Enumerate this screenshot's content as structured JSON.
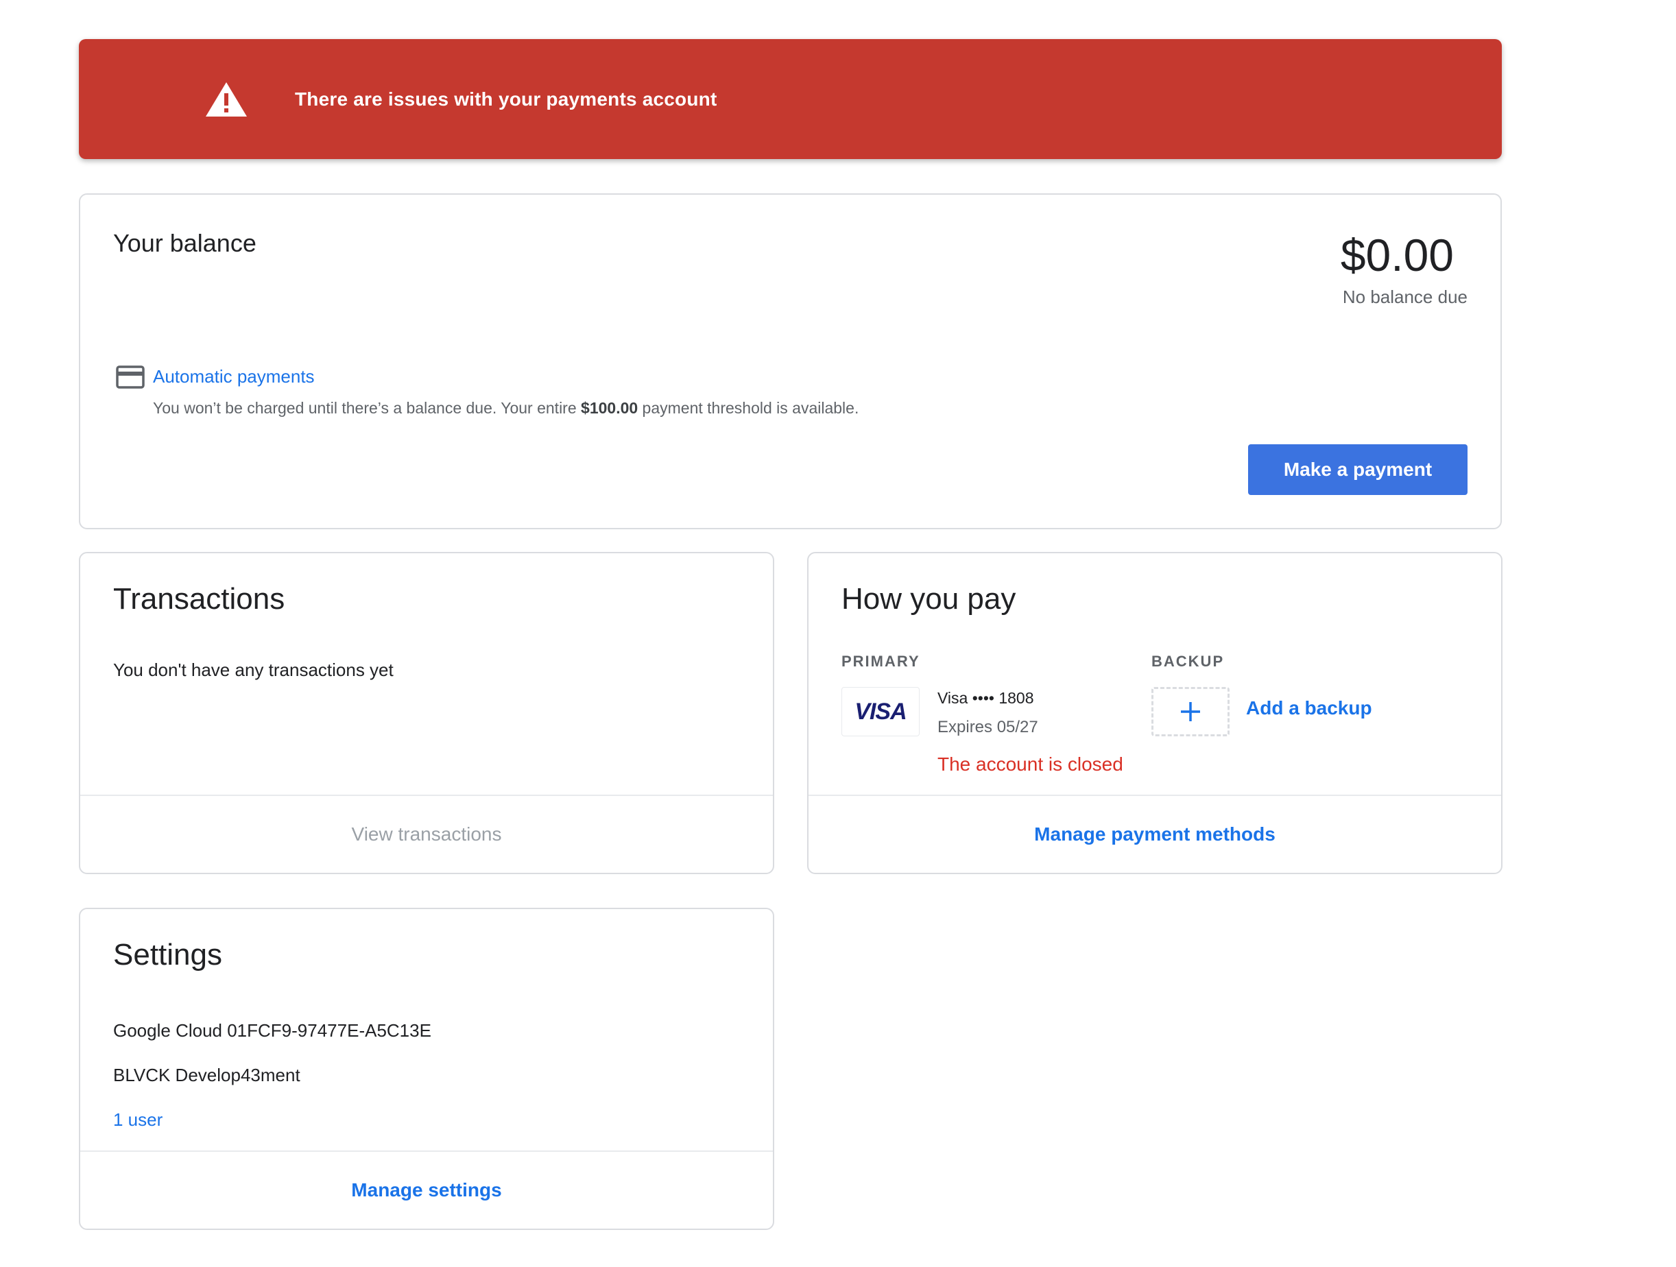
{
  "alert": {
    "text": "There are issues with your payments account",
    "icon": "warning-icon",
    "expand_icon": "chevron-down-icon",
    "color": "#c5392f"
  },
  "balance": {
    "title": "Your balance",
    "amount": "$0.00",
    "status": "No balance due",
    "auto_payments_icon": "credit-card-icon",
    "auto_payments_label": "Automatic payments",
    "auto_payments_desc_before": "You won’t be charged until there’s a balance due. Your entire ",
    "auto_payments_desc_amount": "$100.00",
    "auto_payments_desc_after": " payment threshold is available.",
    "make_payment_label": "Make a payment"
  },
  "transactions": {
    "title": "Transactions",
    "empty_message": "You don't have any transactions yet",
    "view_label": "View transactions"
  },
  "how_you_pay": {
    "title": "How you pay",
    "primary_label": "PRIMARY",
    "backup_label": "BACKUP",
    "card_brand": "VISA",
    "card_line": "Visa •••• 1808",
    "card_expiry": "Expires 05/27",
    "card_error": "The account is closed",
    "add_backup_label": "Add a backup",
    "manage_label": "Manage payment methods"
  },
  "settings": {
    "title": "Settings",
    "account_line": "Google Cloud 01FCF9-97477E-A5C13E",
    "org_name": "BLVCK Develop43ment",
    "users_link": "1 user",
    "manage_label": "Manage settings"
  },
  "colors": {
    "accent": "#1a73e8",
    "button": "#3b73e0",
    "error": "#d93025"
  }
}
